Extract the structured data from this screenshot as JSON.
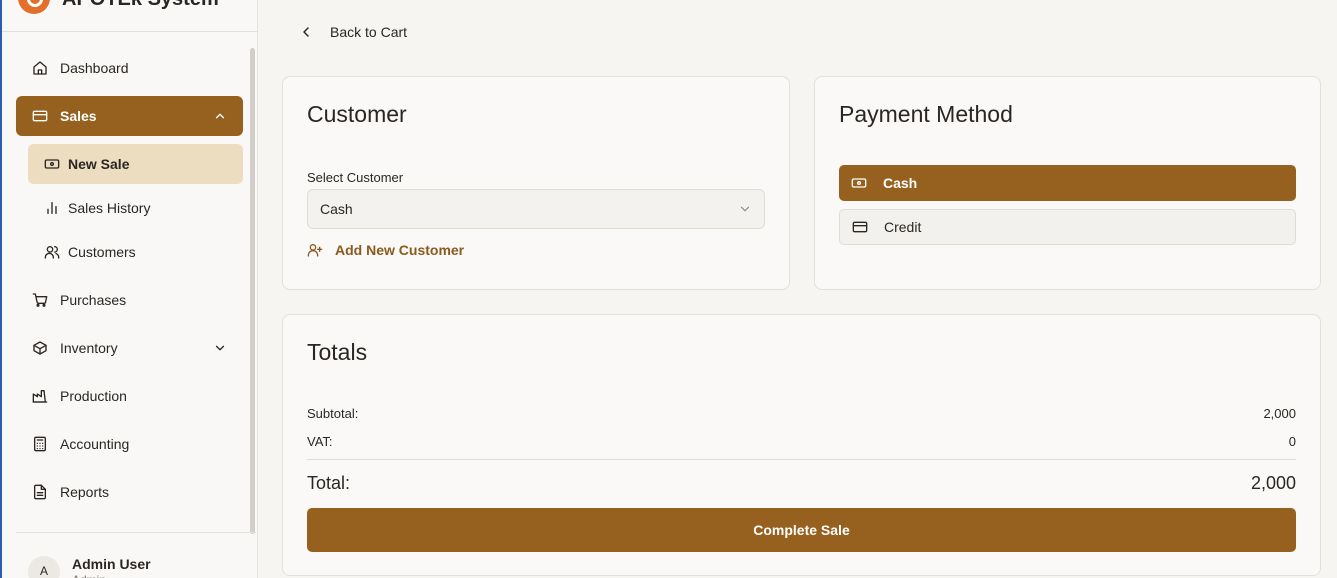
{
  "app": {
    "name": "APOTEk System"
  },
  "colors": {
    "accent": "#96611f",
    "accent_light": "#ecdcc0",
    "logo": "#e2702a"
  },
  "sidebar": {
    "items": [
      {
        "label": "Dashboard",
        "icon": "home-icon"
      },
      {
        "label": "Sales",
        "icon": "credit-card-icon",
        "expanded": true
      },
      {
        "label": "Purchases",
        "icon": "shopping-cart-icon"
      },
      {
        "label": "Inventory",
        "icon": "package-icon"
      },
      {
        "label": "Production",
        "icon": "factory-icon"
      },
      {
        "label": "Accounting",
        "icon": "calculator-icon"
      },
      {
        "label": "Reports",
        "icon": "file-text-icon"
      }
    ],
    "sales_sub": [
      {
        "label": "New Sale",
        "icon": "banknote-icon",
        "selected": true
      },
      {
        "label": "Sales History",
        "icon": "bar-chart-icon"
      },
      {
        "label": "Customers",
        "icon": "users-icon"
      }
    ],
    "user": {
      "initial": "A",
      "name": "Admin User",
      "role": "Admin"
    }
  },
  "main": {
    "back_label": "Back to Cart",
    "customer": {
      "title": "Customer",
      "select_label": "Select Customer",
      "selected_value": "Cash",
      "add_label": "Add New Customer"
    },
    "payment": {
      "title": "Payment Method",
      "options": [
        {
          "label": "Cash",
          "selected": true
        },
        {
          "label": "Credit",
          "selected": false
        }
      ]
    },
    "totals": {
      "title": "Totals",
      "subtotal_label": "Subtotal:",
      "subtotal_value": "2,000",
      "vat_label": "VAT:",
      "vat_value": "0",
      "total_label": "Total:",
      "total_value": "2,000",
      "complete_label": "Complete Sale"
    }
  }
}
